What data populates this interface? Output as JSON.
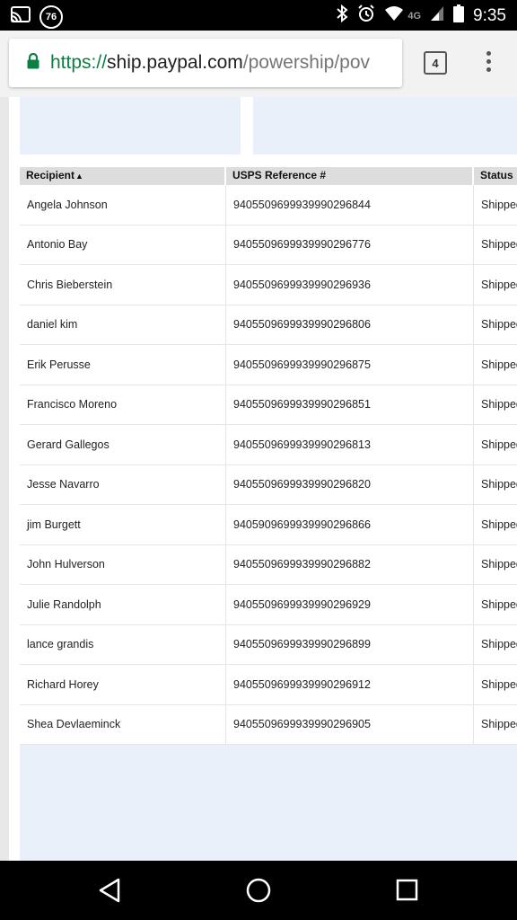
{
  "status_bar": {
    "notification_count": "76",
    "network": "4G",
    "time": "9:35"
  },
  "browser": {
    "url_scheme": "https://",
    "url_host": "ship.paypal.com",
    "url_path": "/powership/pov",
    "tab_count": "4"
  },
  "table": {
    "headers": [
      "Recipient",
      "USPS Reference #",
      "Status"
    ],
    "sort_indicator": "▲",
    "rows": [
      {
        "recipient": "Angela Johnson",
        "ref": "9405509699939990296844",
        "status": "Shipped"
      },
      {
        "recipient": "Antonio Bay",
        "ref": "9405509699939990296776",
        "status": "Shipped"
      },
      {
        "recipient": "Chris Bieberstein",
        "ref": "9405509699939990296936",
        "status": "Shipped"
      },
      {
        "recipient": "daniel kim",
        "ref": "9405509699939990296806",
        "status": "Shipped"
      },
      {
        "recipient": "Erik Perusse",
        "ref": "9405509699939990296875",
        "status": "Shipped"
      },
      {
        "recipient": "Francisco Moreno",
        "ref": "9405509699939990296851",
        "status": "Shipped"
      },
      {
        "recipient": "Gerard Gallegos",
        "ref": "9405509699939990296813",
        "status": "Shipped"
      },
      {
        "recipient": "Jesse Navarro",
        "ref": "9405509699939990296820",
        "status": "Shipped"
      },
      {
        "recipient": "jim Burgett",
        "ref": "9405909699939990296866",
        "status": "Shipped"
      },
      {
        "recipient": "John Hulverson",
        "ref": "9405509699939990296882",
        "status": "Shipped"
      },
      {
        "recipient": "Julie Randolph",
        "ref": "9405509699939990296929",
        "status": "Shipped"
      },
      {
        "recipient": "lance grandis",
        "ref": "9405509699939990296899",
        "status": "Shipped"
      },
      {
        "recipient": "Richard Horey",
        "ref": "9405509699939990296912",
        "status": "Shipped"
      },
      {
        "recipient": "Shea Devlaeminck",
        "ref": "9405509699939990296905",
        "status": "Shipped"
      }
    ]
  },
  "icons": {
    "cast": "cast-icon",
    "bluetooth": "bluetooth-icon",
    "alarm": "alarm-icon",
    "wifi": "wifi-icon",
    "signal": "signal-icon",
    "battery": "battery-icon",
    "lock": "lock-icon",
    "menu": "overflow-menu-icon",
    "back": "back-icon",
    "home": "home-icon",
    "recents": "recents-icon"
  },
  "colors": {
    "secure_green": "#0b8043",
    "panel_bg": "#eaf0f9",
    "header_bg": "#dddddd"
  }
}
